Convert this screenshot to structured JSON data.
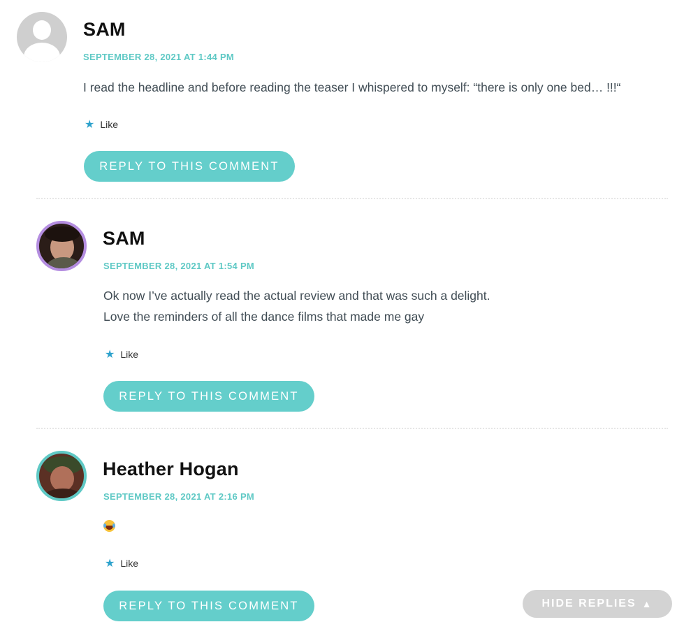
{
  "comments": [
    {
      "author": "SAM",
      "date": "SEPTEMBER 28, 2021 AT 1:44 PM",
      "lines": [
        "I read the headline and before reading the teaser I whispered to myself: “there is only one bed… !!!“"
      ],
      "like_label": "Like",
      "reply_label": "REPLY TO THIS COMMENT",
      "avatar": "default-user-icon"
    },
    {
      "author": "SAM",
      "date": "SEPTEMBER 28, 2021 AT 1:54 PM",
      "lines": [
        "Ok now I’ve actually read the actual review and that was such a delight.",
        "Love the reminders of all the dance films that made me gay"
      ],
      "like_label": "Like",
      "reply_label": "REPLY TO THIS COMMENT",
      "avatar": "user-photo",
      "avatar_ring_color": "#b48de0"
    },
    {
      "author": "Heather Hogan",
      "date": "SEPTEMBER 28, 2021 AT 2:16 PM",
      "emoji": "face-with-tears-of-joy",
      "like_label": "Like",
      "reply_label": "REPLY TO THIS COMMENT",
      "avatar": "user-photo",
      "avatar_ring_color": "#5fc9c5"
    }
  ],
  "hide_replies": {
    "label": "HIDE REPLIES",
    "icon": "triangle-up-icon"
  },
  "colors": {
    "accent": "#64cecb",
    "date": "#5fc9c5",
    "like_star": "#2ea2cc",
    "hide_replies_bg": "#d3d3d3"
  }
}
